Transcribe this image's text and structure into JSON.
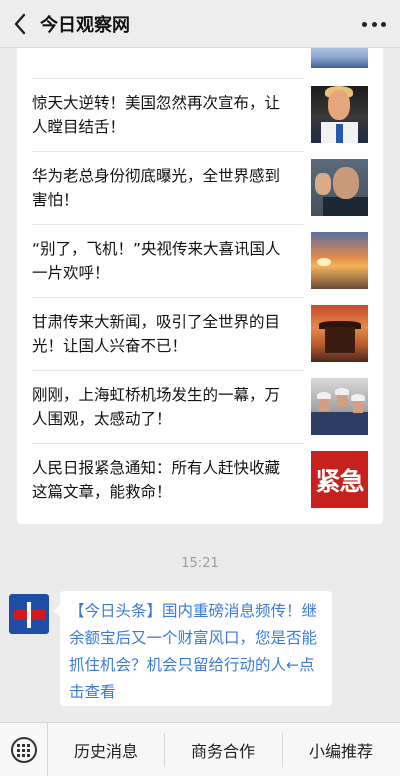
{
  "header": {
    "title": "今日观察网",
    "back_icon": "chevron-left-icon",
    "more_icon": "more-dots-icon"
  },
  "articles": [
    {
      "title": "惊天大逆转！美国忽然再次宣布，让人瞠目结舌！"
    },
    {
      "title": "华为老总身份彻底曝光，全世界感到害怕！"
    },
    {
      "title": "“别了，飞机！”央视传来大喜讯国人一片欢呼！"
    },
    {
      "title": "甘肃传来大新闻，吸引了全世界的目光！让国人兴奋不已！"
    },
    {
      "title": "刚刚，上海虹桥机场发生的一幕，万人围观，太感动了！"
    },
    {
      "title": "人民日报紧急通知：所有人赶快收藏这篇文章，能救命！",
      "thumb_text": "紧急"
    }
  ],
  "timestamp": "15:21",
  "message": {
    "tag": "【今日头条】",
    "text": "国内重磅消息频传！继余额宝后又一个财富风口，您是否能抓住机会？机会只留给行动的人←点击查看"
  },
  "bottom_menu": {
    "keyboard_icon": "keyboard-icon",
    "items": [
      "历史消息",
      "商务合作",
      "小编推荐"
    ]
  },
  "colors": {
    "link_blue": "#3b7bd8",
    "urgent_red": "#c8201d",
    "background": "#ebebeb"
  }
}
